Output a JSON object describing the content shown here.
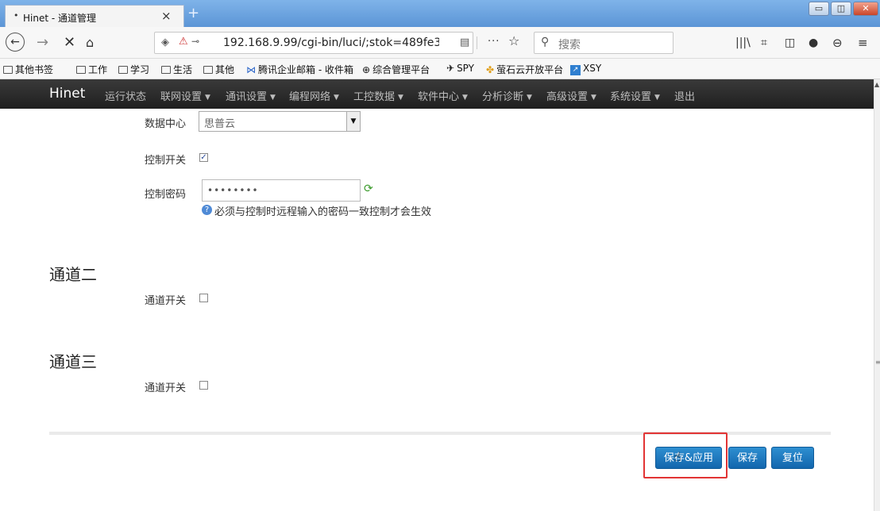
{
  "browser": {
    "tab_title": "Hinet - 通道管理",
    "tab_dot": "•",
    "tab_close": "×",
    "new_tab": "+",
    "window_controls": {
      "minimize": "▭",
      "restore": "◫",
      "close": "✕"
    },
    "url": "192.168.9.99/cgi-bin/luci/;stok=489fe39",
    "search_placeholder": "搜索",
    "more_label": "···",
    "icons": [
      "back-icon",
      "forward-icon",
      "stop-icon",
      "home-icon",
      "shield-icon",
      "insecure-lock-icon",
      "key-icon",
      "reader-view-icon",
      "bookmark-star-icon",
      "search-icon",
      "library-icon",
      "screenshot-icon",
      "sidebar-icon",
      "chat-icon",
      "account-icon",
      "menu-icon"
    ]
  },
  "bookmarks": [
    "其他书签",
    "工作",
    "学习",
    "生活",
    "其他",
    "腾讯企业邮箱 - 收件箱",
    "综合管理平台",
    "SPY",
    "萤石云开放平台",
    "XSY"
  ],
  "app": {
    "brand": "Hinet",
    "menu": [
      {
        "label": "运行状态",
        "caret": ""
      },
      {
        "label": "联网设置",
        "caret": "▼"
      },
      {
        "label": "通讯设置",
        "caret": "▼"
      },
      {
        "label": "编程网络",
        "caret": "▼"
      },
      {
        "label": "工控数据",
        "caret": "▼"
      },
      {
        "label": "软件中心",
        "caret": "▼"
      },
      {
        "label": "分析诊断",
        "caret": "▼"
      },
      {
        "label": "高级设置",
        "caret": "▼"
      },
      {
        "label": "系统设置",
        "caret": "▼"
      },
      {
        "label": "退出",
        "caret": ""
      }
    ]
  },
  "form": {
    "datacenter_label": "数据中心",
    "datacenter_value": "思普云",
    "control_switch_label": "控制开关",
    "control_switch_checked": true,
    "control_password_label": "控制密码",
    "control_password_value": "••••••••",
    "password_hint": "必须与控制时远程输入的密码一致控制才会生效",
    "channel2_title": "通道二",
    "channel2_switch_label": "通道开关",
    "channel3_title": "通道三",
    "channel3_switch_label": "通道开关"
  },
  "actions": {
    "save_apply": "保存&应用",
    "save": "保存",
    "reset": "复位"
  },
  "colors": {
    "accent": "#1f7ac0",
    "highlight": "#e23434",
    "navbar": "#2a2a2a"
  }
}
